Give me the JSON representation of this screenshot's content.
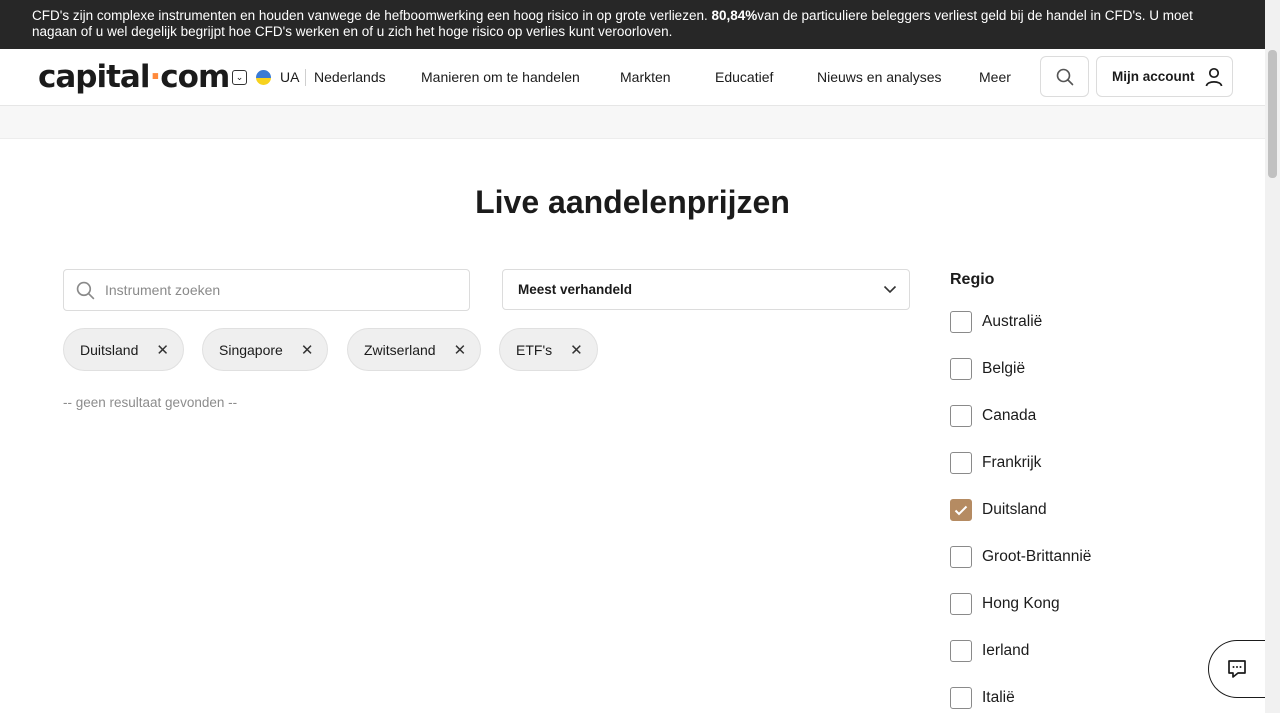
{
  "risk_banner": {
    "text_before": "CFD's zijn complexe instrumenten en houden vanwege de hefboomwerking een hoog risico in op grote verliezen. ",
    "percent": "80,84%",
    "text_after": "van de particuliere beleggers verliest geld bij de handel in CFD's. U moet nagaan of u wel degelijk begrijpt hoe CFD's werken en of u zich het hoge risico op verlies kunt veroorloven."
  },
  "header": {
    "logo_left": "capital",
    "logo_dot": "·",
    "logo_right": "com",
    "country": "UA",
    "language": "Nederlands",
    "nav": [
      "Manieren om te handelen",
      "Markten",
      "Educatief",
      "Nieuws en analyses",
      "Meer"
    ],
    "account_label": "Mijn account"
  },
  "main": {
    "title": "Live aandelenprijzen",
    "search_placeholder": "Instrument zoeken",
    "sort_value": "Meest verhandeld",
    "chips": [
      "Duitsland",
      "Singapore",
      "Zwitserland",
      "ETF's"
    ],
    "no_result": "-- geen resultaat gevonden --"
  },
  "region": {
    "title": "Regio",
    "items": [
      {
        "label": "Australië",
        "checked": false
      },
      {
        "label": "België",
        "checked": false
      },
      {
        "label": "Canada",
        "checked": false
      },
      {
        "label": "Frankrijk",
        "checked": false
      },
      {
        "label": "Duitsland",
        "checked": true
      },
      {
        "label": "Groot-Brittannië",
        "checked": false
      },
      {
        "label": "Hong Kong",
        "checked": false
      },
      {
        "label": "Ierland",
        "checked": false
      },
      {
        "label": "Italië",
        "checked": false
      }
    ]
  },
  "colors": {
    "accent": "#b58b62",
    "banner_bg": "#272727",
    "logo_dot": "#ff8a3c"
  }
}
